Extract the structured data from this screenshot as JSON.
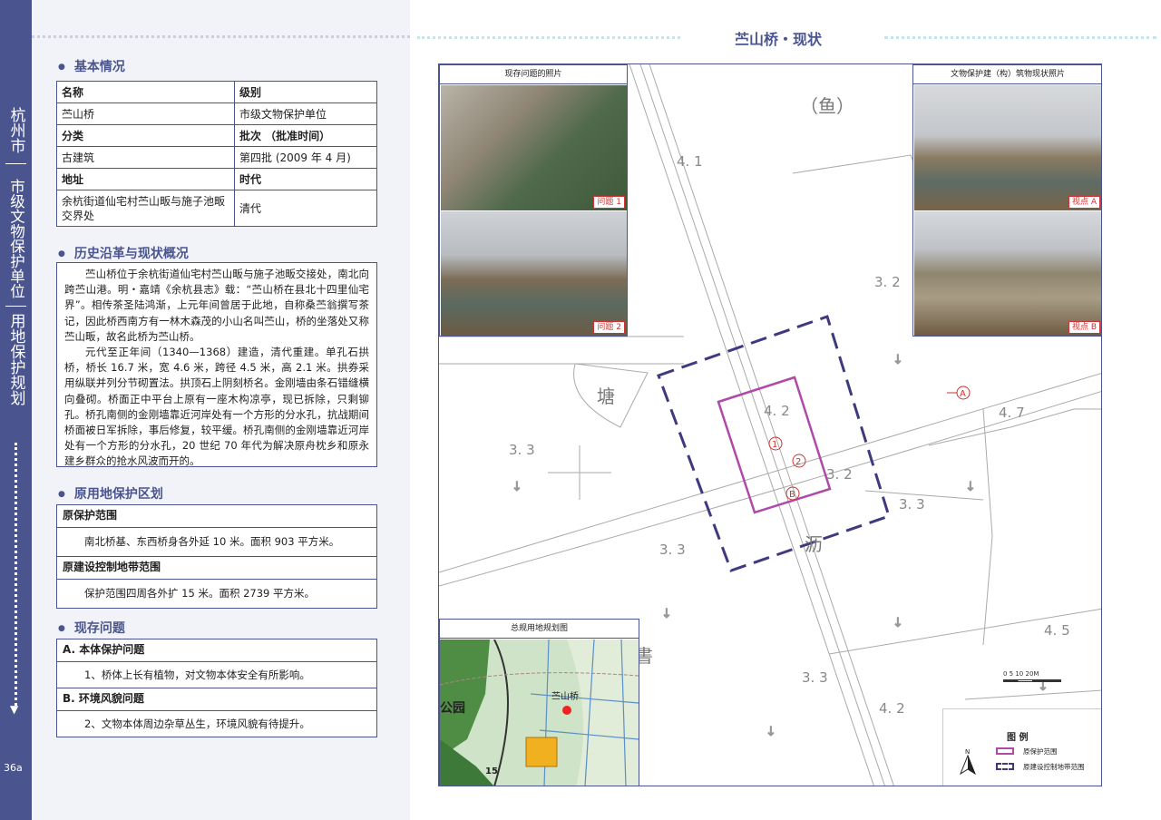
{
  "sidebar": {
    "block1": "杭州市",
    "block2": "市级文物保护单位",
    "block3": "用地保护规划",
    "page_number": "36a"
  },
  "sections": {
    "basic": "基本情况",
    "history": "历史沿革与现状概况",
    "protection": "原用地保护区划",
    "issues": "现存问题"
  },
  "basic_table": {
    "name_label": "名称",
    "name_value": "苎山桥",
    "level_label": "级别",
    "level_value": "市级文物保护单位",
    "category_label": "分类",
    "category_value": "古建筑",
    "batch_label": "批次 （批准时间）",
    "batch_value": "第四批 (2009 年 4 月)",
    "address_label": "地址",
    "address_value": "余杭街道仙宅村苎山畈与施子池畈交界处",
    "era_label": "时代",
    "era_value": "清代"
  },
  "history": {
    "p1": "苎山桥位于余杭街道仙宅村苎山畈与施子池畈交接处，南北向跨苎山港。明・嘉靖《余杭县志》载：“苎山桥在县北十四里仙宅界”。相传茶圣陆鸿渐，上元年间曾居于此地，自称桑苎翁撰写茶记，因此桥西南方有一林木森茂的小山名叫苎山，桥的坐落处又称苎山畈，故名此桥为苎山桥。",
    "p2": "元代至正年间（1340—1368）建造，清代重建。单孔石拱桥，桥长 16.7 米，宽 4.6 米，跨径 4.5 米，高 2.1 米。拱券采用纵联并列分节砌置法。拱顶石上阴刻桥名。金刚墙由条石错缝横向叠砌。桥面正中平台上原有一座木构凉亭，现已拆除，只剩铆孔。桥孔南侧的金刚墙靠近河岸处有一个方形的分水孔，抗战期间桥面被日军拆除，事后修复，较平缓。桥孔南侧的金刚墙靠近河岸处有一个方形的分水孔，20 世纪 70 年代为解决原舟枕乡和原永建乡群众的抢水风波而开的。"
  },
  "protection": {
    "h1": "原保护范围",
    "t1": "南北桥基、东西桥身各外延 10 米。面积 903 平方米。",
    "h2": "原建设控制地带范围",
    "t2": "保护范围四周各外扩 15 米。面积 2739 平方米。"
  },
  "issues": {
    "h1": "A. 本体保护问题",
    "t1": "1、桥体上长有植物，对文物本体安全有所影响。",
    "h2": "B. 环境风貌问题",
    "t2": "2、文物本体周边杂草丛生，环境风貌有待提升。"
  },
  "right": {
    "title": "苎山桥・现状",
    "photos_left_title": "现存问题的照片",
    "photos_right_title": "文物保护建（构）筑物现状照片",
    "cap1": "问题 1",
    "cap2": "问题 2",
    "capA": "视点 A",
    "capB": "视点 B",
    "site_plan_title": "总规用地规划图",
    "site_plan_label": "苎山桥",
    "site_plan_park": "公园",
    "site_plan_num": "15",
    "legend_title": "图 例",
    "legend_1": "原保护范围",
    "legend_2": "原建设控制地带范围",
    "north": "N",
    "scale": "0   5   10        20M",
    "map_labels": {
      "yu": "（鱼）",
      "tang": "塘",
      "li": "沥",
      "shu": "書",
      "e1": "4. 1",
      "e2": "3. 2",
      "e3": "3. 2",
      "e4": "4. 2",
      "e5": "4. 7",
      "e6": "3. 3",
      "e7": "3. 2",
      "e8": "3. 3",
      "e9": "3. 3",
      "e10": "4. 5",
      "e11": "3. 3",
      "e12": "4. 2",
      "m1": "1",
      "m2": "2",
      "mA": "A",
      "mB": "B"
    }
  },
  "colors": {
    "brand": "#4a5590",
    "inner": "#b04aa8",
    "outer": "#3e3a80",
    "marker": "#c33"
  }
}
